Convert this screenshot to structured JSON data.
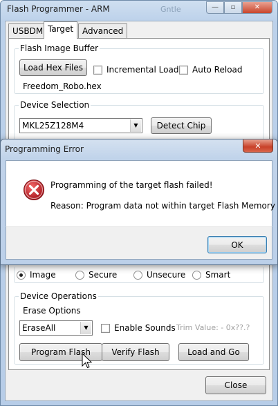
{
  "window": {
    "title": "Flash Programmer - ARM",
    "ghost_title": "Gntle",
    "minimize": "—",
    "maximize": "▫",
    "close": "✕"
  },
  "tabs": [
    {
      "label": "USBDM"
    },
    {
      "label": "Target"
    },
    {
      "label": "Advanced"
    }
  ],
  "flash_image": {
    "legend": "Flash Image Buffer",
    "load_button": "Load Hex Files",
    "incremental_load": "Incremental Load",
    "auto_reload": "Auto Reload",
    "filename": "Freedom_Robo.hex"
  },
  "device_selection": {
    "legend": "Device Selection",
    "device": "MKL25Z128M4",
    "detect_button": "Detect Chip"
  },
  "security": {
    "options": [
      {
        "label": "Image",
        "checked": true
      },
      {
        "label": "Secure",
        "checked": false
      },
      {
        "label": "Unsecure",
        "checked": false
      },
      {
        "label": "Smart",
        "checked": false
      }
    ]
  },
  "device_operations": {
    "legend": "Device Operations",
    "erase_label": "Erase Options",
    "erase_value": "EraseAll",
    "enable_sounds": "Enable Sounds",
    "trim_value": "Trim Value: - 0x??.?",
    "program_button": "Program Flash",
    "verify_button": "Verify Flash",
    "load_go_button": "Load and Go"
  },
  "footer": {
    "close_button": "Close"
  },
  "dialog": {
    "title": "Programming Error",
    "close": "✕",
    "message": "Programming of the target flash failed!",
    "reason": "Reason: Program data not within target Flash Memory",
    "ok_button": "OK",
    "icon": "error-icon",
    "icon_color": "#c8232c"
  }
}
